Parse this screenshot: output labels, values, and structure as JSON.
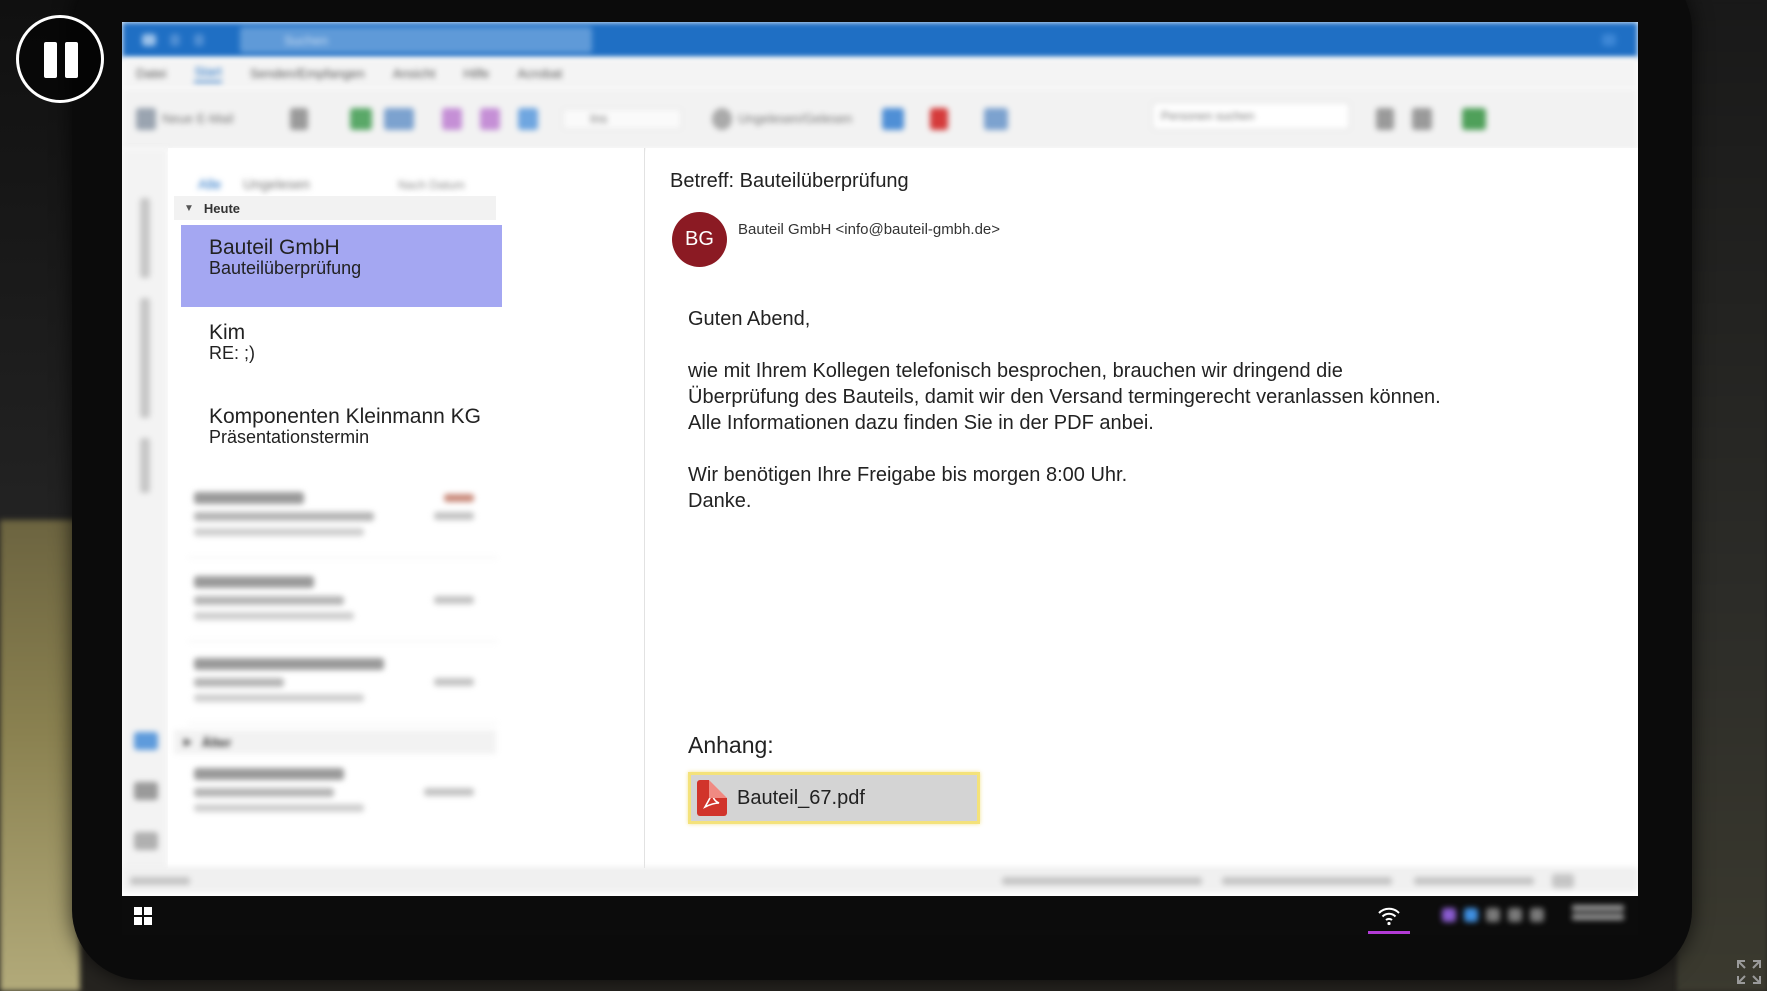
{
  "window": {
    "search_placeholder": "Suchen"
  },
  "menu": {
    "items": [
      "Datei",
      "Start",
      "Senden/Empfangen",
      "Ansicht",
      "Hilfe",
      "Acrobat"
    ]
  },
  "ribbon": {
    "new_mail": "Neue E-Mail",
    "move_to": "Ins",
    "unread_read": "Ungelesen/Gelesen",
    "find_people": "Personen suchen"
  },
  "list": {
    "filter_all": "Alle",
    "filter_unread": "Ungelesen",
    "sort": "Nach Datum",
    "group_today": "Heute",
    "group_older": "Älter",
    "messages": [
      {
        "from": "Bauteil GmbH",
        "subject": "Bauteilüberprüfung"
      },
      {
        "from": "Kim",
        "subject": "RE: ;)"
      },
      {
        "from": "Komponenten Kleinmann KG",
        "subject": "Präsentationstermin"
      }
    ]
  },
  "reading": {
    "subject": "Betreff: Bauteilüberprüfung",
    "avatar_initials": "BG",
    "avatar_color": "#8b1a23",
    "sender": "Bauteil GmbH <info@bauteil-gmbh.de>",
    "body": {
      "greeting": "Guten Abend,",
      "line1": "wie mit Ihrem Kollegen telefonisch besprochen, brauchen wir dringend die",
      "line2": "Überprüfung des Bauteils, damit wir den Versand termingerecht veranlassen können.",
      "line3": "Alle Informationen dazu finden Sie in der PDF anbei.",
      "line4": "Wir benötigen Ihre Freigabe bis morgen 8:00 Uhr.",
      "line5": "Danke."
    },
    "attachment_label": "Anhang:",
    "attachment_name": "Bauteil_67.pdf",
    "attachment_icon": "pdf-file-icon"
  },
  "colors": {
    "accent": "#1f6fc4",
    "selected_row": "#a4a7f2",
    "attachment_highlight": "#f4e27a"
  },
  "overlay": {
    "pause_icon": "pause-icon",
    "fullscreen_icon": "fullscreen-icon"
  }
}
